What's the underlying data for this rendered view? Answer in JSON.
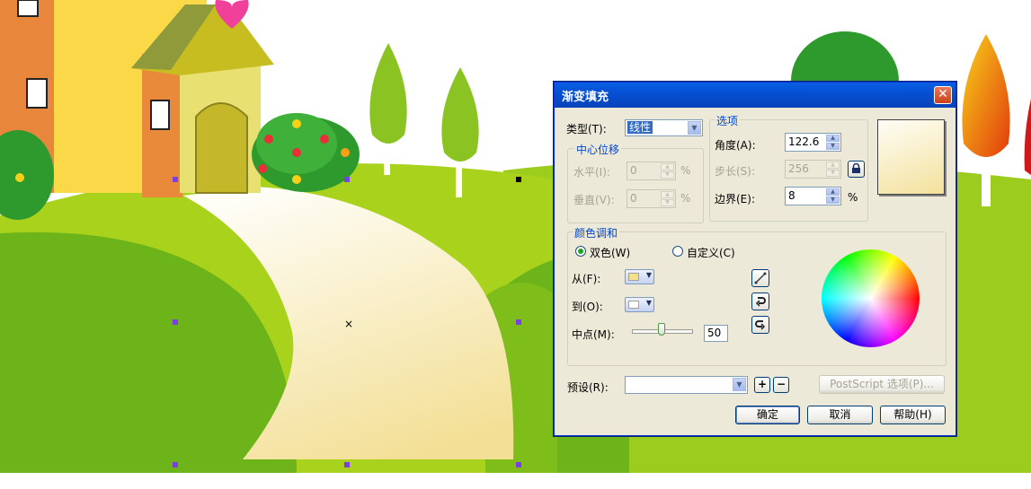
{
  "dialog": {
    "title": "渐变填充",
    "close_label": "✕",
    "type_label": "类型(T):",
    "type_value": "线性",
    "center_offset": {
      "title": "中心位移",
      "horizontal_label": "水平(I):",
      "horizontal_value": "0",
      "vertical_label": "垂直(V):",
      "vertical_value": "0",
      "unit": "%"
    },
    "options": {
      "title": "选项",
      "angle_label": "角度(A):",
      "angle_value": "122.6",
      "steps_label": "步长(S):",
      "steps_value": "256",
      "edge_label": "边界(E):",
      "edge_value": "8",
      "unit": "%"
    },
    "color_blend": {
      "title": "颜色调和",
      "two_color_label": "双色(W)",
      "custom_label": "自定义(C)",
      "selected": "two_color",
      "from_label": "从(F):",
      "from_color": "#f5e08c",
      "to_label": "到(O):",
      "to_color": "#ffffff",
      "midpoint_label": "中点(M):",
      "midpoint_value": "50",
      "direction_buttons": [
        "linear-direction-icon",
        "counterclockwise-icon",
        "clockwise-icon"
      ]
    },
    "presets_label": "预设(R):",
    "presets_value": "",
    "postscript_label": "PostScript 选项(P)...",
    "ok_label": "确定",
    "cancel_label": "取消",
    "help_label": "帮助(H)",
    "preview_gradient": [
      "#fefdf6",
      "#f3e19c"
    ]
  },
  "canvas": {
    "selection_handle_color": "#7b3fe4",
    "center_mark": "×"
  }
}
